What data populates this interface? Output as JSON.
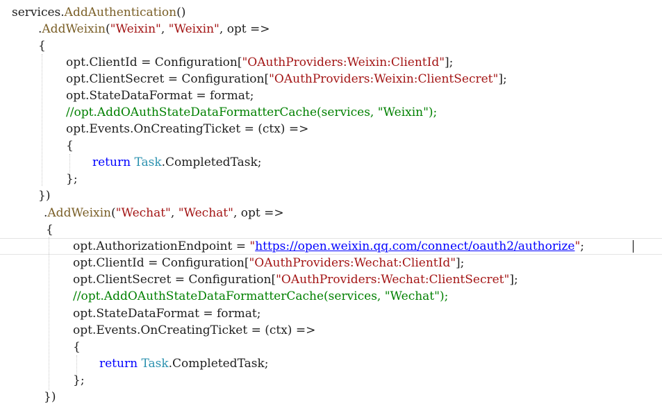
{
  "editor": {
    "lines": [
      {
        "tokens": [
          {
            "t": "services",
            "c": "id"
          },
          {
            "t": ".",
            "c": "p"
          },
          {
            "t": "AddAuthentication",
            "c": "m"
          },
          {
            "t": "()",
            "c": "p"
          }
        ]
      },
      {
        "tokens": [
          {
            "t": ".",
            "c": "p"
          },
          {
            "t": "AddWeixin",
            "c": "m"
          },
          {
            "t": "(",
            "c": "p"
          },
          {
            "t": "\"Weixin\"",
            "c": "s"
          },
          {
            "t": ", ",
            "c": "p"
          },
          {
            "t": "\"Weixin\"",
            "c": "s"
          },
          {
            "t": ", ",
            "c": "p"
          },
          {
            "t": "opt",
            "c": "id"
          },
          {
            "t": " =>",
            "c": "op"
          }
        ]
      },
      {
        "tokens": [
          {
            "t": "{",
            "c": "p"
          }
        ]
      },
      {
        "tokens": [
          {
            "t": "opt",
            "c": "id"
          },
          {
            "t": ".",
            "c": "p"
          },
          {
            "t": "ClientId",
            "c": "id"
          },
          {
            "t": " = ",
            "c": "op"
          },
          {
            "t": "Configuration",
            "c": "id"
          },
          {
            "t": "[",
            "c": "p"
          },
          {
            "t": "\"OAuthProviders:Weixin:ClientId\"",
            "c": "s"
          },
          {
            "t": "];",
            "c": "p"
          }
        ]
      },
      {
        "tokens": [
          {
            "t": "opt",
            "c": "id"
          },
          {
            "t": ".",
            "c": "p"
          },
          {
            "t": "ClientSecret",
            "c": "id"
          },
          {
            "t": " = ",
            "c": "op"
          },
          {
            "t": "Configuration",
            "c": "id"
          },
          {
            "t": "[",
            "c": "p"
          },
          {
            "t": "\"OAuthProviders:Weixin:ClientSecret\"",
            "c": "s"
          },
          {
            "t": "];",
            "c": "p"
          }
        ]
      },
      {
        "tokens": [
          {
            "t": "opt",
            "c": "id"
          },
          {
            "t": ".",
            "c": "p"
          },
          {
            "t": "StateDataFormat",
            "c": "id"
          },
          {
            "t": " = ",
            "c": "op"
          },
          {
            "t": "format",
            "c": "id"
          },
          {
            "t": ";",
            "c": "p"
          }
        ]
      },
      {
        "tokens": [
          {
            "t": "//opt.AddOAuthStateDataFormatterCache(services, \"Weixin\");",
            "c": "c"
          }
        ]
      },
      {
        "tokens": [
          {
            "t": "opt",
            "c": "id"
          },
          {
            "t": ".",
            "c": "p"
          },
          {
            "t": "Events",
            "c": "id"
          },
          {
            "t": ".",
            "c": "p"
          },
          {
            "t": "OnCreatingTicket",
            "c": "id"
          },
          {
            "t": " = ",
            "c": "op"
          },
          {
            "t": "(ctx)",
            "c": "id"
          },
          {
            "t": " =>",
            "c": "op"
          }
        ]
      },
      {
        "tokens": [
          {
            "t": "{",
            "c": "p"
          }
        ]
      },
      {
        "tokens": [
          {
            "t": "return",
            "c": "k"
          },
          {
            "t": " ",
            "c": "p"
          },
          {
            "t": "Task",
            "c": "t"
          },
          {
            "t": ".",
            "c": "p"
          },
          {
            "t": "CompletedTask",
            "c": "id"
          },
          {
            "t": ";",
            "c": "p"
          }
        ]
      },
      {
        "tokens": [
          {
            "t": "};",
            "c": "p"
          }
        ]
      },
      {
        "tokens": [
          {
            "t": "})",
            "c": "p"
          }
        ]
      },
      {
        "tokens": [
          {
            "t": ".",
            "c": "p"
          },
          {
            "t": "AddWeixin",
            "c": "m"
          },
          {
            "t": "(",
            "c": "p"
          },
          {
            "t": "\"Wechat\"",
            "c": "s"
          },
          {
            "t": ", ",
            "c": "p"
          },
          {
            "t": "\"Wechat\"",
            "c": "s"
          },
          {
            "t": ", ",
            "c": "p"
          },
          {
            "t": "opt",
            "c": "id"
          },
          {
            "t": " =>",
            "c": "op"
          }
        ]
      },
      {
        "tokens": [
          {
            "t": "{",
            "c": "p"
          }
        ]
      },
      {
        "tokens": [
          {
            "t": "opt",
            "c": "id"
          },
          {
            "t": ".",
            "c": "p"
          },
          {
            "t": "AuthorizationEndpoint",
            "c": "id"
          },
          {
            "t": " = ",
            "c": "op"
          },
          {
            "t": "\"",
            "c": "s"
          },
          {
            "t": "https://open.weixin.qq.com/connect/oauth2/authorize",
            "c": "url"
          },
          {
            "t": "\"",
            "c": "s"
          },
          {
            "t": ";",
            "c": "p"
          }
        ]
      },
      {
        "tokens": [
          {
            "t": "opt",
            "c": "id"
          },
          {
            "t": ".",
            "c": "p"
          },
          {
            "t": "ClientId",
            "c": "id"
          },
          {
            "t": " = ",
            "c": "op"
          },
          {
            "t": "Configuration",
            "c": "id"
          },
          {
            "t": "[",
            "c": "p"
          },
          {
            "t": "\"OAuthProviders:Wechat:ClientId\"",
            "c": "s"
          },
          {
            "t": "];",
            "c": "p"
          }
        ]
      },
      {
        "tokens": [
          {
            "t": "opt",
            "c": "id"
          },
          {
            "t": ".",
            "c": "p"
          },
          {
            "t": "ClientSecret",
            "c": "id"
          },
          {
            "t": " = ",
            "c": "op"
          },
          {
            "t": "Configuration",
            "c": "id"
          },
          {
            "t": "[",
            "c": "p"
          },
          {
            "t": "\"OAuthProviders:Wechat:ClientSecret\"",
            "c": "s"
          },
          {
            "t": "];",
            "c": "p"
          }
        ]
      },
      {
        "tokens": [
          {
            "t": "//opt.AddOAuthStateDataFormatterCache(services, \"Wechat\");",
            "c": "c"
          }
        ]
      },
      {
        "tokens": [
          {
            "t": "opt",
            "c": "id"
          },
          {
            "t": ".",
            "c": "p"
          },
          {
            "t": "StateDataFormat",
            "c": "id"
          },
          {
            "t": " = ",
            "c": "op"
          },
          {
            "t": "format",
            "c": "id"
          },
          {
            "t": ";",
            "c": "p"
          }
        ]
      },
      {
        "tokens": [
          {
            "t": "opt",
            "c": "id"
          },
          {
            "t": ".",
            "c": "p"
          },
          {
            "t": "Events",
            "c": "id"
          },
          {
            "t": ".",
            "c": "p"
          },
          {
            "t": "OnCreatingTicket",
            "c": "id"
          },
          {
            "t": " = ",
            "c": "op"
          },
          {
            "t": "(ctx)",
            "c": "id"
          },
          {
            "t": " =>",
            "c": "op"
          }
        ]
      },
      {
        "tokens": [
          {
            "t": "{",
            "c": "p"
          }
        ]
      },
      {
        "tokens": [
          {
            "t": "return",
            "c": "k"
          },
          {
            "t": " ",
            "c": "p"
          },
          {
            "t": "Task",
            "c": "t"
          },
          {
            "t": ".",
            "c": "p"
          },
          {
            "t": "CompletedTask",
            "c": "id"
          },
          {
            "t": ";",
            "c": "p"
          }
        ]
      },
      {
        "tokens": [
          {
            "t": "};",
            "c": "p"
          }
        ]
      },
      {
        "tokens": [
          {
            "t": "})",
            "c": "p"
          }
        ]
      }
    ],
    "colors": {
      "method": "#795e26",
      "string": "#a31515",
      "keyword": "#0000ff",
      "comment": "#008000",
      "type": "#2b91af",
      "identifier": "#1e1e1e",
      "background": "#ffffff"
    }
  }
}
